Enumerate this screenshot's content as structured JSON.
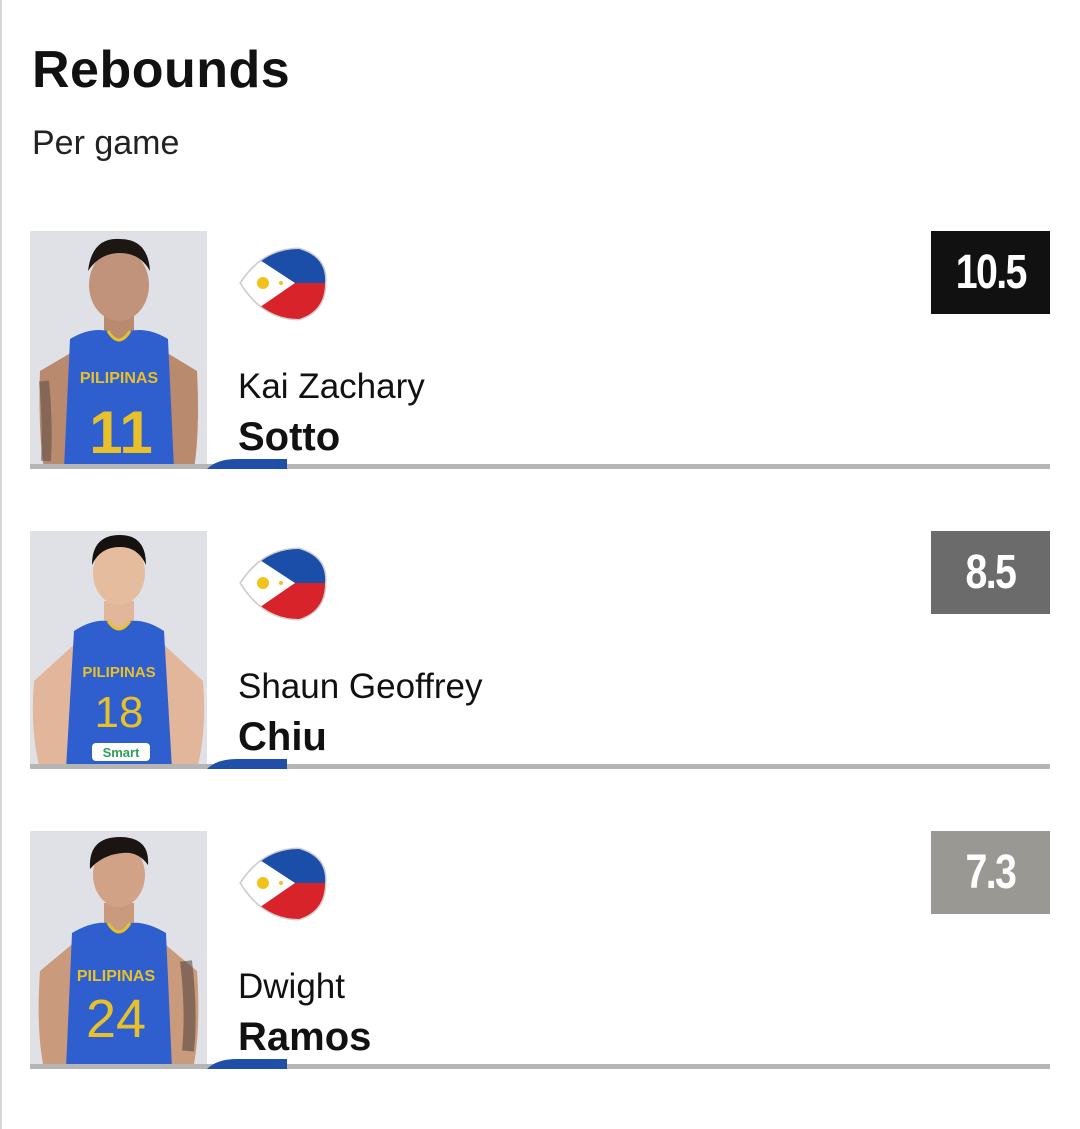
{
  "header": {
    "title": "Rebounds",
    "subtitle": "Per game"
  },
  "accent_color": "#1f4fa8",
  "leaders": [
    {
      "first_name": "Kai Zachary",
      "last_name": "Sotto",
      "value": "10.5",
      "value_bg": "#111111",
      "jersey_text": "PILIPINAS",
      "jersey_number": "11",
      "flag_icon": "philippines-flag-icon"
    },
    {
      "first_name": "Shaun Geoffrey",
      "last_name": "Chiu",
      "value": "8.5",
      "value_bg": "#6b6b6b",
      "jersey_text": "PILIPINAS",
      "jersey_number": "18",
      "sponsor": "Smart",
      "flag_icon": "philippines-flag-icon"
    },
    {
      "first_name": "Dwight",
      "last_name": "Ramos",
      "value": "7.3",
      "value_bg": "#9a9893",
      "jersey_text": "PILIPINAS",
      "jersey_number": "24",
      "flag_icon": "philippines-flag-icon"
    }
  ]
}
